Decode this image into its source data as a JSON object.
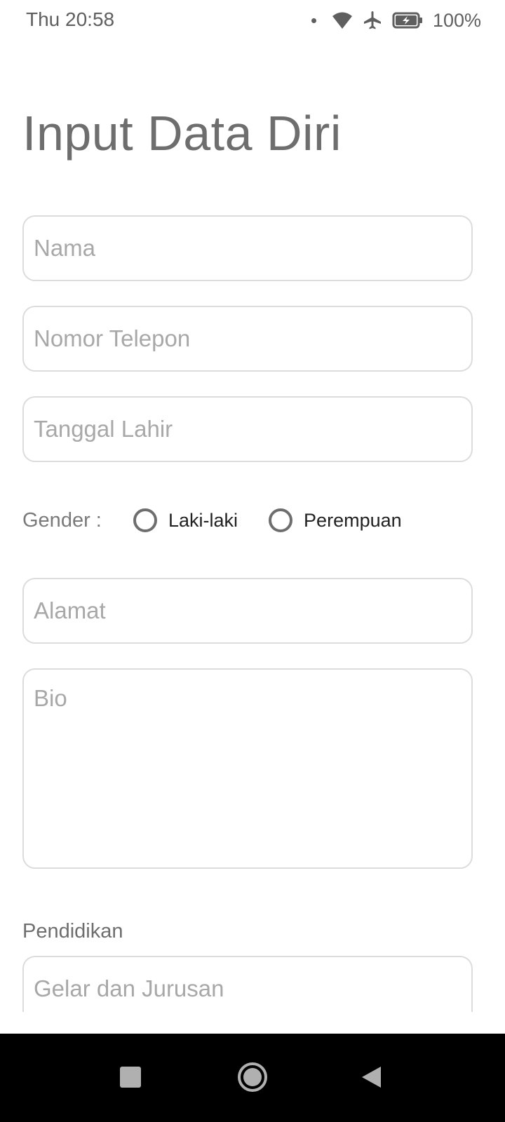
{
  "status_bar": {
    "time": "Thu 20:58",
    "battery_percent": "100%",
    "icons": [
      "notification-dot-icon",
      "wifi-icon",
      "airplane-icon",
      "battery-charging-icon"
    ]
  },
  "form": {
    "title": "Input Data Diri",
    "fields": {
      "nama": {
        "placeholder": "Nama",
        "value": ""
      },
      "telepon": {
        "placeholder": "Nomor Telepon",
        "value": ""
      },
      "tanggal_lahir": {
        "placeholder": "Tanggal Lahir",
        "value": ""
      },
      "alamat": {
        "placeholder": "Alamat",
        "value": ""
      },
      "bio": {
        "placeholder": "Bio",
        "value": ""
      },
      "gelar": {
        "placeholder": "Gelar dan Jurusan",
        "value": ""
      }
    },
    "gender": {
      "label": "Gender :",
      "options": [
        "Laki-laki",
        "Perempuan"
      ],
      "selected": null
    },
    "education_label": "Pendidikan"
  },
  "nav_bar": {
    "buttons": [
      "recents-square-icon",
      "home-circle-icon",
      "back-triangle-icon"
    ]
  },
  "colors": {
    "title": "#6e6e6e",
    "border": "#dcdcdc",
    "placeholder": "#a8a8a8",
    "nav_background": "#000000"
  }
}
